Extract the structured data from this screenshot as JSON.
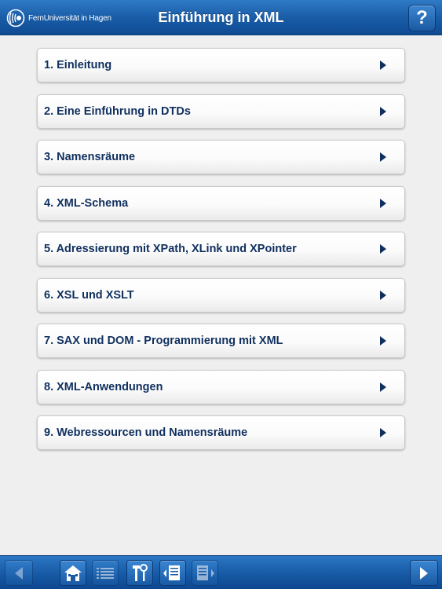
{
  "header": {
    "logo_text": "FernUniversität in Hagen",
    "title": "Einführung in XML",
    "help_label": "?"
  },
  "menu": {
    "items": [
      {
        "label": "1. Einleitung"
      },
      {
        "label": "2. Eine Einführung in DTDs"
      },
      {
        "label": "3. Namensräume"
      },
      {
        "label": "4. XML-Schema"
      },
      {
        "label": "5. Adressierung mit XPath, XLink und XPointer"
      },
      {
        "label": "6. XSL und XSLT"
      },
      {
        "label": "7. SAX und DOM - Programmierung mit XML"
      },
      {
        "label": "8. XML-Anwendungen"
      },
      {
        "label": "9. Webressourcen und Namensräume"
      }
    ]
  },
  "toolbar": {
    "icons": [
      "back-arrow-icon",
      "home-icon",
      "list-icon",
      "tools-icon",
      "page-prev-icon",
      "page-next-icon",
      "forward-arrow-icon"
    ]
  },
  "colors": {
    "header_blue": "#1a5da8",
    "item_text": "#0f2f5e",
    "background": "#efefef"
  }
}
